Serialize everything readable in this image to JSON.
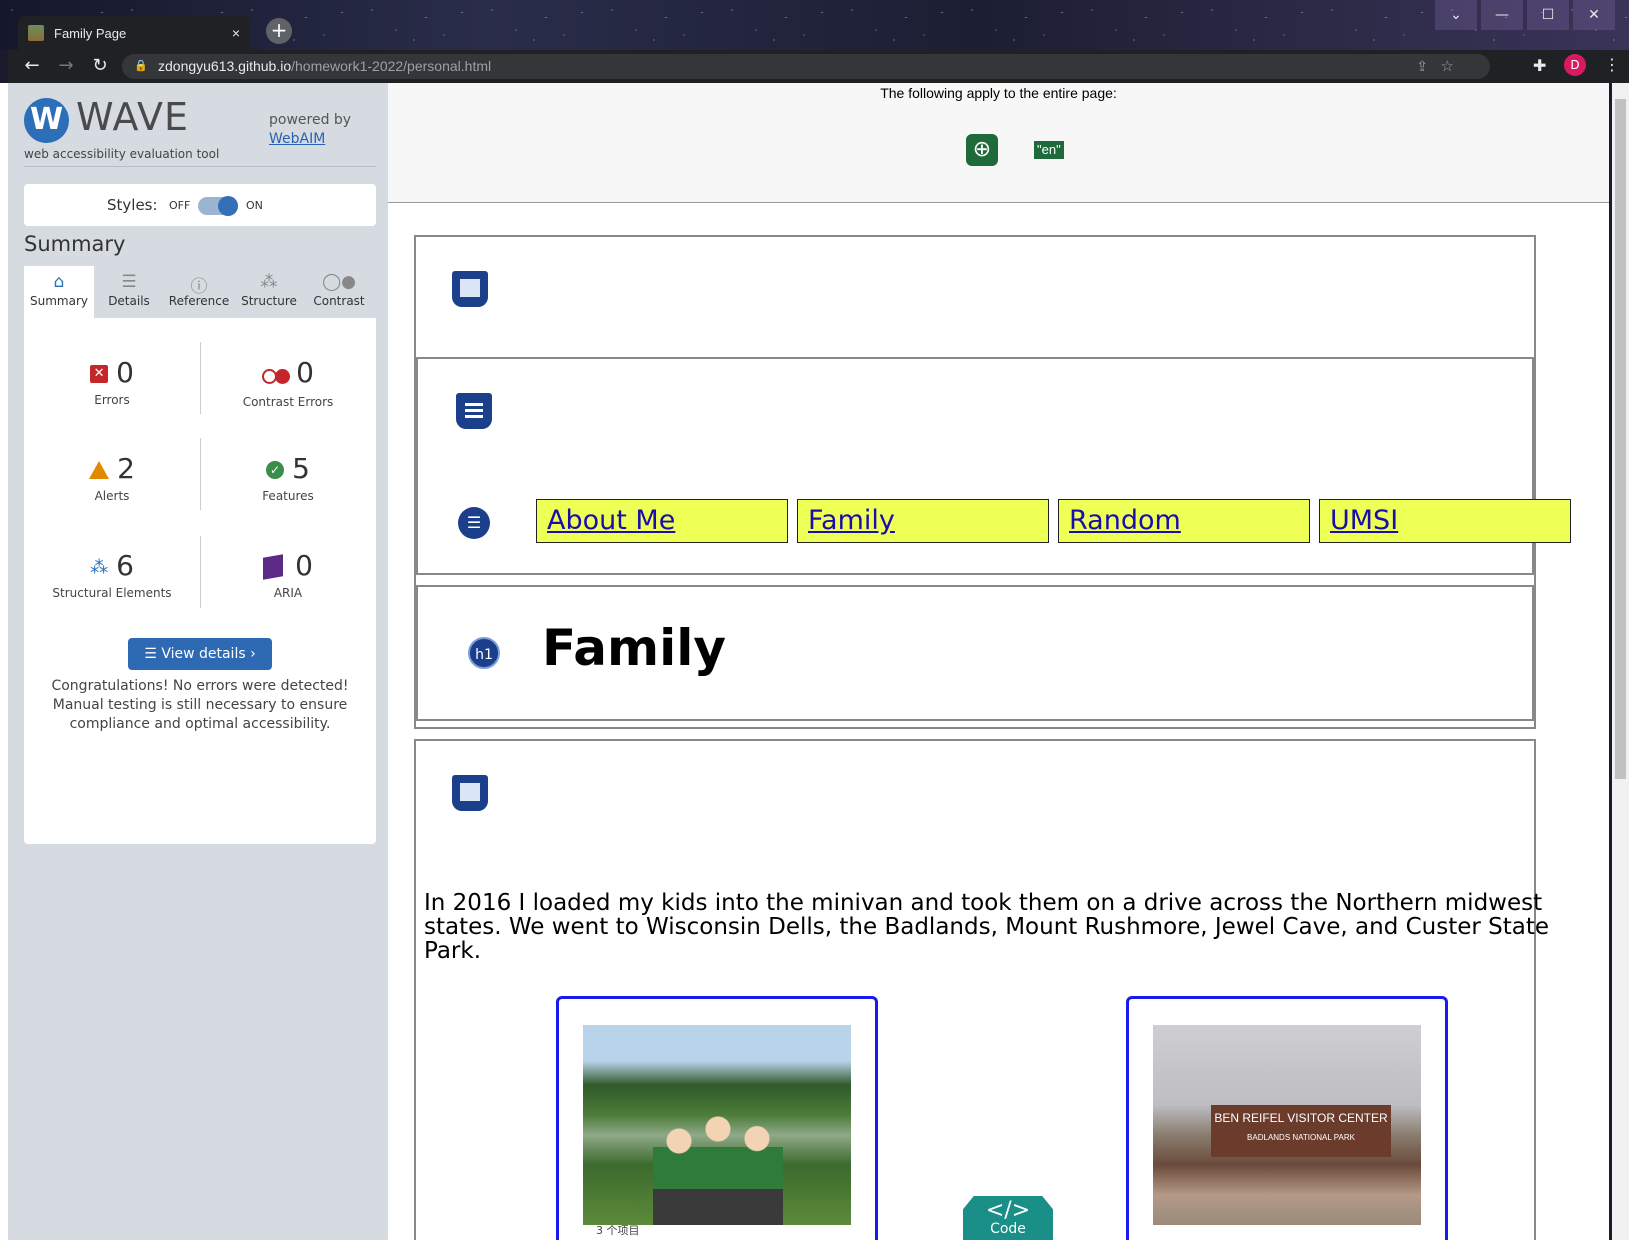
{
  "browser": {
    "tab_title": "Family Page",
    "tab_close": "×",
    "new_tab": "+",
    "url_host": "zdongyu613.github.io",
    "url_path": "/homework1-2022/personal.html",
    "avatar_letter": "D",
    "window_controls": [
      "⌄",
      "—",
      "☐",
      "✕"
    ]
  },
  "wave": {
    "logo_letter": "W",
    "logo_text": "WAVE",
    "logo_subtitle": "web accessibility evaluation tool",
    "powered_by": "powered by",
    "webaim_link": "WebAIM",
    "styles_label": "Styles:",
    "styles_off": "OFF",
    "styles_on": "ON",
    "styles_state": "on",
    "summary_heading": "Summary",
    "tabs": [
      {
        "label": "Summary",
        "icon": "home-icon",
        "active": true
      },
      {
        "label": "Details",
        "icon": "list-icon",
        "active": false
      },
      {
        "label": "Reference",
        "icon": "info-icon",
        "active": false
      },
      {
        "label": "Structure",
        "icon": "structure-icon",
        "active": false
      },
      {
        "label": "Contrast",
        "icon": "contrast-icon",
        "active": false
      }
    ],
    "stats": {
      "errors": {
        "count": "0",
        "label": "Errors"
      },
      "contrast_errors": {
        "count": "0",
        "label": "Contrast Errors"
      },
      "alerts": {
        "count": "2",
        "label": "Alerts"
      },
      "features": {
        "count": "5",
        "label": "Features"
      },
      "structural": {
        "count": "6",
        "label": "Structural Elements"
      },
      "aria": {
        "count": "0",
        "label": "ARIA"
      }
    },
    "view_details": "View details ›",
    "congrats": "Congratulations! No errors were detected! Manual testing is still necessary to ensure compliance and optimal accessibility."
  },
  "page": {
    "applies_text": "The following apply to the entire page:",
    "lang_badge": "\"en\"",
    "nav_links": [
      "About Me",
      "Family",
      "Random",
      "UMSI"
    ],
    "h1_badge": "h1",
    "heading": "Family",
    "paragraph": "In 2016 I loaded my kids into the minivan and took them on a drive across the Northern midwest states. We went to Wisconsin Dells, the Badlands, Mount Rushmore, Jewel Cave, and Custer State Park.",
    "photo2_sign": "BEN REIFEL VISITOR CENTER",
    "photo2_sign_sub": "BADLANDS NATIONAL PARK",
    "code_button": "Code",
    "code_glyph": "</>",
    "footer_fragment": "3 个项目"
  },
  "colors": {
    "wave_blue": "#2c6fb8",
    "nav_link_bg": "#eeff55",
    "figure_border": "#1a1aee",
    "code_button": "#1a8f87",
    "sidebar_bg": "#d6dbe2"
  }
}
